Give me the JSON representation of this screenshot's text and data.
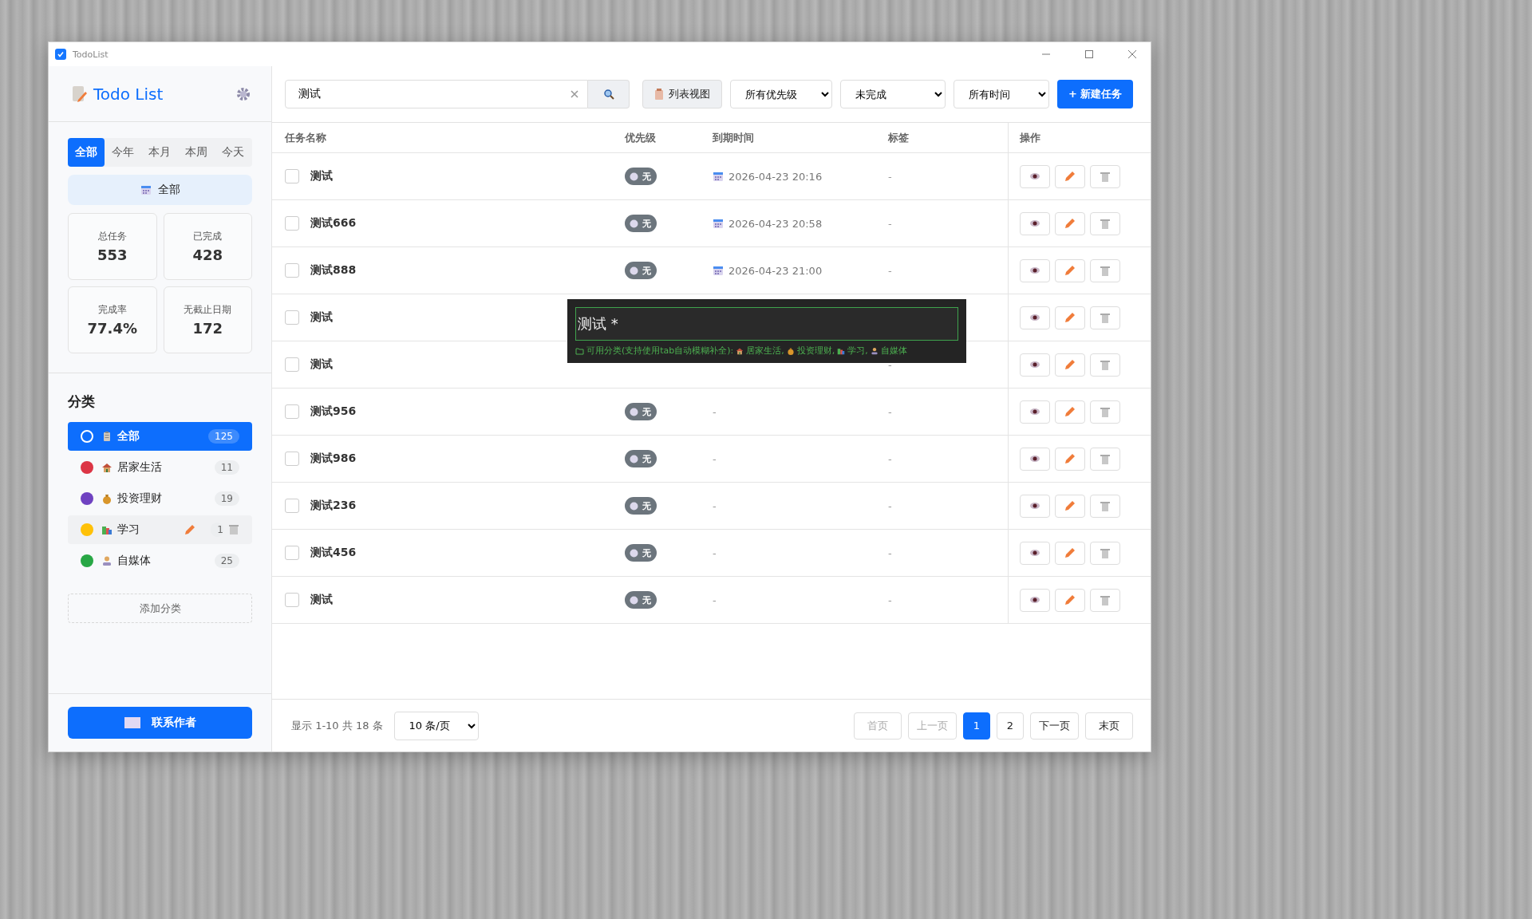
{
  "window": {
    "title": "TodoList"
  },
  "sidebar": {
    "app_title": "Todo List",
    "time_tabs": [
      {
        "label": "全部",
        "selected": true
      },
      {
        "label": "今年",
        "selected": false
      },
      {
        "label": "本月",
        "selected": false
      },
      {
        "label": "本周",
        "selected": false
      },
      {
        "label": "今天",
        "selected": false
      }
    ],
    "scope_label": "全部",
    "stats": [
      {
        "label": "总任务",
        "value": "553"
      },
      {
        "label": "已完成",
        "value": "428"
      },
      {
        "label": "完成率",
        "value": "77.4%"
      },
      {
        "label": "无截止日期",
        "value": "172"
      }
    ],
    "categories_heading": "分类",
    "categories": [
      {
        "name": "全部",
        "count": "125",
        "selected": true,
        "hovered": false,
        "color": "#ffffff",
        "kind": "all"
      },
      {
        "name": "居家生活",
        "count": "11",
        "selected": false,
        "hovered": false,
        "color": "#dc3545",
        "kind": "home"
      },
      {
        "name": "投资理财",
        "count": "19",
        "selected": false,
        "hovered": false,
        "color": "#6f42c1",
        "kind": "money"
      },
      {
        "name": "学习",
        "count": "1",
        "selected": false,
        "hovered": true,
        "color": "#ffc107",
        "kind": "books"
      },
      {
        "name": "自媒体",
        "count": "25",
        "selected": false,
        "hovered": false,
        "color": "#28a745",
        "kind": "person"
      }
    ],
    "add_category": "添加分类",
    "contact_button": "联系作者"
  },
  "toolbar": {
    "search_value": "测试",
    "view_button": "列表视图",
    "priority_filter": "所有优先级",
    "status_filter": "未完成",
    "time_filter": "所有时间",
    "new_task_button": "+ 新建任务"
  },
  "table": {
    "columns": [
      "任务名称",
      "优先级",
      "到期时间",
      "标签",
      "操作"
    ],
    "rows": [
      {
        "name": "测试",
        "checked": false,
        "priority": "无",
        "due": "2026-04-23 20:16",
        "tag": "-"
      },
      {
        "name": "测试666",
        "checked": false,
        "priority": "无",
        "due": "2026-04-23 20:58",
        "tag": "-"
      },
      {
        "name": "测试888",
        "checked": false,
        "priority": "无",
        "due": "2026-04-23 21:00",
        "tag": "-"
      },
      {
        "name": "测试",
        "checked": false
      },
      {
        "name": "测试",
        "checked": false,
        "tag": "-"
      },
      {
        "name": "测试956",
        "checked": false,
        "priority": "无",
        "due": "-",
        "tag": "-"
      },
      {
        "name": "测试986",
        "checked": false,
        "priority": "无",
        "due": "-",
        "tag": "-"
      },
      {
        "name": "测试236",
        "checked": false,
        "priority": "无",
        "due": "-",
        "tag": "-"
      },
      {
        "name": "测试456",
        "checked": false,
        "priority": "无",
        "due": "-",
        "tag": "-"
      },
      {
        "name": "测试",
        "checked": false,
        "priority": "无",
        "due": "-",
        "tag": "-"
      }
    ]
  },
  "quick_input": {
    "value": "测试 *",
    "hint": "可用分类(支持使用tab自动模糊补全):",
    "categories": [
      {
        "name": "居家生活,",
        "kind": "home"
      },
      {
        "name": "投资理财,",
        "kind": "money"
      },
      {
        "name": "学习,",
        "kind": "books"
      },
      {
        "name": "自媒体",
        "kind": "person"
      }
    ]
  },
  "pagination": {
    "summary": "显示 1-10 共 18 条",
    "page_size": "10 条/页",
    "first": "首页",
    "prev": "上一页",
    "pages": [
      {
        "label": "1",
        "selected": true
      },
      {
        "label": "2",
        "selected": false
      }
    ],
    "next": "下一页",
    "last": "末页"
  }
}
